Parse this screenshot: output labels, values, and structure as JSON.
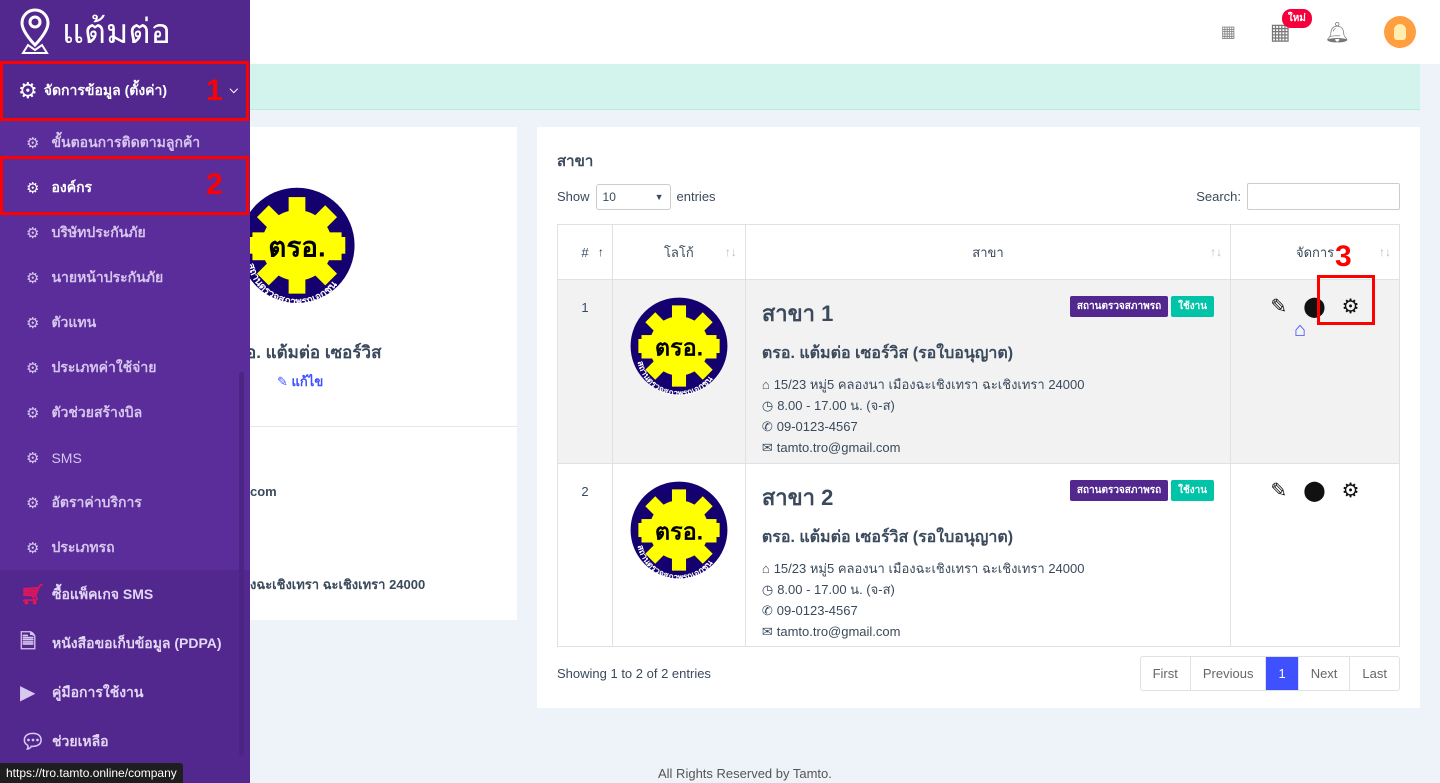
{
  "sidebar": {
    "brand": "แต้มต่อ",
    "main_menu": "จัดการข้อมูล (ตั้งค่า)",
    "sub_items": [
      {
        "label": "ขั้นตอนการติดตามลูกค้า"
      },
      {
        "label": "องค์กร",
        "active": true
      },
      {
        "label": "บริษัทประกันภัย"
      },
      {
        "label": "นายหน้าประกันภัย"
      },
      {
        "label": "ตัวแทน"
      },
      {
        "label": "ประเภทค่าใช้จ่าย"
      },
      {
        "label": "ตัวช่วยสร้างบิล"
      },
      {
        "label": "SMS"
      },
      {
        "label": "อัตราค่าบริการ"
      },
      {
        "label": "ประเภทรถ"
      }
    ],
    "extra_items": [
      {
        "label": "ซื้อแพ็คเกจ SMS",
        "icon": "cart-plus-icon"
      },
      {
        "label": "หนังสือขอเก็บข้อมูล (PDPA)",
        "icon": "file-icon"
      },
      {
        "label": "คู่มือการใช้งาน",
        "icon": "youtube-icon"
      },
      {
        "label": "ช่วยเหลือ",
        "icon": "line-icon"
      }
    ]
  },
  "annotations": [
    "1",
    "2",
    "3"
  ],
  "topbar": {
    "new_badge": "ใหม่"
  },
  "company": {
    "name_partial": "อ. แต้มต่อ เซอร์วิส",
    "edit": "แก้ไข",
    "email_partial": "com",
    "address_partial": "งฉะเชิงเทรา ฉะเชิงเทรา 24000"
  },
  "branch_card": {
    "title": "สาขา",
    "show": "Show",
    "entries": "entries",
    "page_length": "10",
    "search_label": "Search:",
    "search_value": "",
    "columns": [
      "#",
      "โลโก้",
      "สาขา",
      "จัดการ"
    ],
    "rows": [
      {
        "no": "1",
        "name": "สาขา 1",
        "company": "ตรอ. แต้มต่อ เซอร์วิส (รอใบอนุญาต)",
        "badge_type": "สถานตรวจสภาพรถ",
        "badge_status": "ใช้งาน",
        "address": "15/23 หมู่5 คลองนา เมืองฉะเชิงเทรา ฉะเชิงเทรา 24000",
        "hours": "8.00 - 17.00 น. (จ-ส)",
        "phone": "09-0123-4567",
        "email": "tamto.tro@gmail.com",
        "main_branch": true
      },
      {
        "no": "2",
        "name": "สาขา 2",
        "company": "ตรอ. แต้มต่อ เซอร์วิส (รอใบอนุญาต)",
        "badge_type": "สถานตรวจสภาพรถ",
        "badge_status": "ใช้งาน",
        "address": "15/23 หมู่5 คลองนา เมืองฉะเชิงเทรา ฉะเชิงเทรา 24000",
        "hours": "8.00 - 17.00 น. (จ-ส)",
        "phone": "09-0123-4567",
        "email": "tamto.tro@gmail.com",
        "main_branch": false
      }
    ],
    "info": "Showing 1 to 2 of 2 entries",
    "pagination": [
      "First",
      "Previous",
      "1",
      "Next",
      "Last"
    ]
  },
  "logo_text": {
    "abbr": "ตรอ.",
    "ring": "สถานตรวจสภาพรถเอกชน"
  },
  "footer": "All Rights Reserved by Tamto.",
  "status_url": "https://tro.tamto.online/company",
  "colors": {
    "sidebar": "#52288f",
    "badge_type": "#52288f",
    "badge_status": "#00c4a7",
    "accent": "#3f51ff",
    "annotation": "#ff0000"
  }
}
